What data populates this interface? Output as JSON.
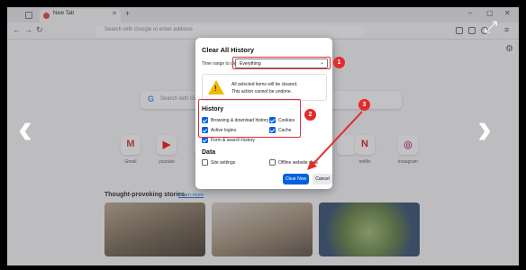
{
  "browser": {
    "tab_title": "New Tab",
    "url_placeholder": "Search with Google or enter address"
  },
  "page": {
    "search_placeholder": "Search with Google or enter address",
    "shortcuts": [
      {
        "label": "Gmail",
        "glyph": "M",
        "color": "#d93025"
      },
      {
        "label": "youtube",
        "glyph": "▶",
        "color": "#ff0000"
      },
      {
        "label": "",
        "glyph": "",
        "color": "#888888"
      },
      {
        "label": "",
        "glyph": "",
        "color": "#888888"
      },
      {
        "label": "",
        "glyph": "",
        "color": "#888888"
      },
      {
        "label": "",
        "glyph": "",
        "color": "#888888"
      },
      {
        "label": "netflix",
        "glyph": "N",
        "color": "#e50914"
      },
      {
        "label": "instagram",
        "glyph": "◎",
        "color": "#c13584"
      }
    ],
    "stories_title": "Thought-provoking stories",
    "learn_more": "Learn more"
  },
  "dialog": {
    "title": "Clear All History",
    "time_range_label": "Time range to clear:",
    "time_range_value": "Everything",
    "warning_line1": "All selected items will be cleared.",
    "warning_line2": "This action cannot be undone.",
    "history_title": "History",
    "history_items": [
      {
        "label": "Browsing & download history",
        "checked": true
      },
      {
        "label": "Cookies",
        "checked": true
      },
      {
        "label": "Active logins",
        "checked": true
      },
      {
        "label": "Cache",
        "checked": true
      },
      {
        "label": "Form & search history",
        "checked": true
      }
    ],
    "data_title": "Data",
    "data_items": [
      {
        "label": "Site settings",
        "checked": false
      },
      {
        "label": "Offline website data",
        "checked": false
      }
    ],
    "clear_now": "Clear Now",
    "cancel": "Cancel"
  },
  "annotations": {
    "badge1": "1",
    "badge2": "2",
    "badge3": "3",
    "color": "#e42b2b"
  }
}
